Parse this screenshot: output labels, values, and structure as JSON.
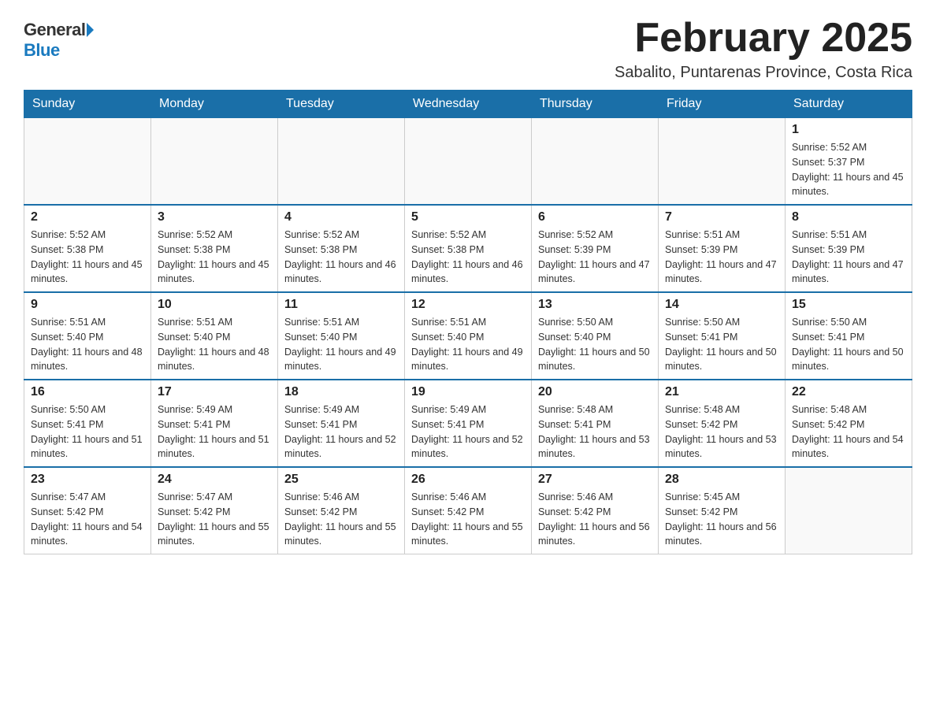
{
  "header": {
    "logo_general": "General",
    "logo_blue": "Blue",
    "month_title": "February 2025",
    "location": "Sabalito, Puntarenas Province, Costa Rica"
  },
  "weekdays": [
    "Sunday",
    "Monday",
    "Tuesday",
    "Wednesday",
    "Thursday",
    "Friday",
    "Saturday"
  ],
  "weeks": [
    [
      {
        "day": "",
        "empty": true
      },
      {
        "day": "",
        "empty": true
      },
      {
        "day": "",
        "empty": true
      },
      {
        "day": "",
        "empty": true
      },
      {
        "day": "",
        "empty": true
      },
      {
        "day": "",
        "empty": true
      },
      {
        "day": "1",
        "sunrise": "5:52 AM",
        "sunset": "5:37 PM",
        "daylight": "11 hours and 45 minutes."
      }
    ],
    [
      {
        "day": "2",
        "sunrise": "5:52 AM",
        "sunset": "5:38 PM",
        "daylight": "11 hours and 45 minutes."
      },
      {
        "day": "3",
        "sunrise": "5:52 AM",
        "sunset": "5:38 PM",
        "daylight": "11 hours and 45 minutes."
      },
      {
        "day": "4",
        "sunrise": "5:52 AM",
        "sunset": "5:38 PM",
        "daylight": "11 hours and 46 minutes."
      },
      {
        "day": "5",
        "sunrise": "5:52 AM",
        "sunset": "5:38 PM",
        "daylight": "11 hours and 46 minutes."
      },
      {
        "day": "6",
        "sunrise": "5:52 AM",
        "sunset": "5:39 PM",
        "daylight": "11 hours and 47 minutes."
      },
      {
        "day": "7",
        "sunrise": "5:51 AM",
        "sunset": "5:39 PM",
        "daylight": "11 hours and 47 minutes."
      },
      {
        "day": "8",
        "sunrise": "5:51 AM",
        "sunset": "5:39 PM",
        "daylight": "11 hours and 47 minutes."
      }
    ],
    [
      {
        "day": "9",
        "sunrise": "5:51 AM",
        "sunset": "5:40 PM",
        "daylight": "11 hours and 48 minutes."
      },
      {
        "day": "10",
        "sunrise": "5:51 AM",
        "sunset": "5:40 PM",
        "daylight": "11 hours and 48 minutes."
      },
      {
        "day": "11",
        "sunrise": "5:51 AM",
        "sunset": "5:40 PM",
        "daylight": "11 hours and 49 minutes."
      },
      {
        "day": "12",
        "sunrise": "5:51 AM",
        "sunset": "5:40 PM",
        "daylight": "11 hours and 49 minutes."
      },
      {
        "day": "13",
        "sunrise": "5:50 AM",
        "sunset": "5:40 PM",
        "daylight": "11 hours and 50 minutes."
      },
      {
        "day": "14",
        "sunrise": "5:50 AM",
        "sunset": "5:41 PM",
        "daylight": "11 hours and 50 minutes."
      },
      {
        "day": "15",
        "sunrise": "5:50 AM",
        "sunset": "5:41 PM",
        "daylight": "11 hours and 50 minutes."
      }
    ],
    [
      {
        "day": "16",
        "sunrise": "5:50 AM",
        "sunset": "5:41 PM",
        "daylight": "11 hours and 51 minutes."
      },
      {
        "day": "17",
        "sunrise": "5:49 AM",
        "sunset": "5:41 PM",
        "daylight": "11 hours and 51 minutes."
      },
      {
        "day": "18",
        "sunrise": "5:49 AM",
        "sunset": "5:41 PM",
        "daylight": "11 hours and 52 minutes."
      },
      {
        "day": "19",
        "sunrise": "5:49 AM",
        "sunset": "5:41 PM",
        "daylight": "11 hours and 52 minutes."
      },
      {
        "day": "20",
        "sunrise": "5:48 AM",
        "sunset": "5:41 PM",
        "daylight": "11 hours and 53 minutes."
      },
      {
        "day": "21",
        "sunrise": "5:48 AM",
        "sunset": "5:42 PM",
        "daylight": "11 hours and 53 minutes."
      },
      {
        "day": "22",
        "sunrise": "5:48 AM",
        "sunset": "5:42 PM",
        "daylight": "11 hours and 54 minutes."
      }
    ],
    [
      {
        "day": "23",
        "sunrise": "5:47 AM",
        "sunset": "5:42 PM",
        "daylight": "11 hours and 54 minutes."
      },
      {
        "day": "24",
        "sunrise": "5:47 AM",
        "sunset": "5:42 PM",
        "daylight": "11 hours and 55 minutes."
      },
      {
        "day": "25",
        "sunrise": "5:46 AM",
        "sunset": "5:42 PM",
        "daylight": "11 hours and 55 minutes."
      },
      {
        "day": "26",
        "sunrise": "5:46 AM",
        "sunset": "5:42 PM",
        "daylight": "11 hours and 55 minutes."
      },
      {
        "day": "27",
        "sunrise": "5:46 AM",
        "sunset": "5:42 PM",
        "daylight": "11 hours and 56 minutes."
      },
      {
        "day": "28",
        "sunrise": "5:45 AM",
        "sunset": "5:42 PM",
        "daylight": "11 hours and 56 minutes."
      },
      {
        "day": "",
        "empty": true
      }
    ]
  ]
}
